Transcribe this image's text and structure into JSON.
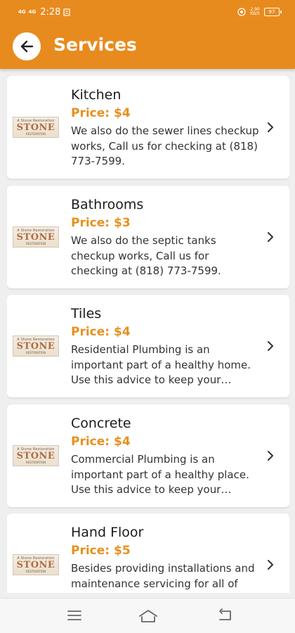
{
  "status_bar": {
    "signal_1": "4G",
    "signal_2": "4G",
    "time": "2:28",
    "speed_value": "2.90",
    "speed_unit": "KB/S",
    "battery": "97"
  },
  "header": {
    "title": "Services",
    "accent_color": "#e88b1e"
  },
  "thumbnail": {
    "line1": "A Stone Restoration",
    "line2": "STONE",
    "line3": "RESTORATION"
  },
  "services": [
    {
      "title": "Kitchen",
      "price": "Price: $4",
      "description": "We also do the sewer lines checkup works, Call us for checking at (818) 773-7599."
    },
    {
      "title": "Bathrooms",
      "price": "Price: $3",
      "description": "We also do the septic tanks checkup works, Call us for checking at (818) 773-7599."
    },
    {
      "title": "Tiles",
      "price": "Price: $4",
      "description": "Residential Plumbing is an important part of a healthy home. Use this advice to keep your plumbing in good shape."
    },
    {
      "title": "Concrete",
      "price": "Price: $4",
      "description": "Commercial Plumbing is an important part of a healthy place. Use this advice to keep your plumbing in good shape."
    },
    {
      "title": "Hand Floor",
      "price": "Price: $5",
      "description": "Besides providing installations and maintenance servicing for all of your needs."
    }
  ],
  "icons": {
    "back": "arrow-left-icon",
    "chevron": "chevron-right-icon",
    "nav_menu": "menu-icon",
    "nav_home": "home-icon",
    "nav_back": "back-icon"
  }
}
